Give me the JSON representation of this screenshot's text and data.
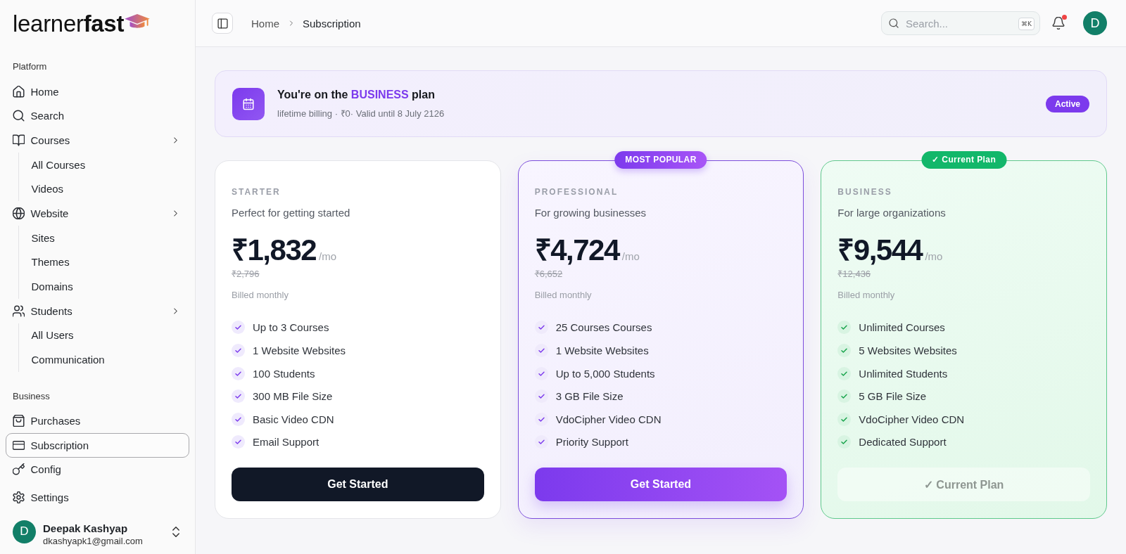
{
  "sidebar": {
    "logo": "learner**fast**",
    "sections": [
      {
        "label": "Platform",
        "items": [
          {
            "label": "Home",
            "selected": false
          },
          {
            "label": "Search",
            "selected": false
          },
          {
            "label": "Courses",
            "selected": false,
            "children": [
              {
                "label": "All Courses",
                "selected": false
              },
              {
                "label": "Videos",
                "selected": false
              }
            ]
          },
          {
            "label": "Website",
            "selected": false,
            "children": [
              {
                "label": "Sites",
                "selected": false
              },
              {
                "label": "Themes",
                "selected": false
              },
              {
                "label": "Domains",
                "selected": false
              }
            ]
          },
          {
            "label": "Students",
            "selected": false,
            "children": [
              {
                "label": "All Users",
                "selected": false
              },
              {
                "label": "Communication",
                "selected": false
              }
            ]
          }
        ]
      },
      {
        "label": "Business",
        "items": [
          {
            "label": "Purchases",
            "selected": false
          },
          {
            "label": "Subscription",
            "selected": true
          },
          {
            "label": "Config",
            "selected": false
          }
        ]
      },
      {
        "items": [
          {
            "label": "Settings",
            "selected": false
          }
        ]
      }
    ],
    "user": {
      "avatar": "D",
      "name": "Deepak Kashyap",
      "email": "dkashyapk1@gmail.com"
    }
  },
  "header": {
    "breadcrumb": [
      "Home",
      "Subscription"
    ],
    "search": {
      "placeholder": "Search...",
      "shortcut": "⌘K"
    },
    "notifications": {
      "unread": true
    },
    "avatar": "D"
  },
  "banner": {
    "title": "You're on the **BUSINESS** plan",
    "details": "lifetime billing · ₹0· Valid until 8 July 2126",
    "status": "Active"
  },
  "plans": [
    {
      "kind": "standard",
      "name": "STARTER",
      "tagline": "Perfect for getting started",
      "price": "₹1,832",
      "period": "/mo",
      "original_price": "₹2,796",
      "billing": "Billed monthly",
      "features": [
        "Up to 3 Courses",
        "1 Website Websites",
        "100 Students",
        "300 MB File Size",
        "Basic Video CDN",
        "Email Support"
      ],
      "button": {
        "label": "Get Started",
        "disabled": false
      }
    },
    {
      "kind": "featured",
      "badge": "MOST POPULAR",
      "name": "PROFESSIONAL",
      "tagline": "For growing businesses",
      "price": "₹4,724",
      "period": "/mo",
      "original_price": "₹6,652",
      "billing": "Billed monthly",
      "features": [
        "25 Courses Courses",
        "1 Website Websites",
        "Up to 5,000 Students",
        "3 GB File Size",
        "VdoCipher Video CDN",
        "Priority Support"
      ],
      "button": {
        "label": "Get Started",
        "disabled": false
      }
    },
    {
      "kind": "current",
      "badge": "✓ Current Plan",
      "name": "BUSINESS",
      "tagline": "For large organizations",
      "price": "₹9,544",
      "period": "/mo",
      "original_price": "₹12,436",
      "billing": "Billed monthly",
      "features": [
        "Unlimited Courses",
        "5 Websites Websites",
        "Unlimited Students",
        "5 GB File Size",
        "VdoCipher Video CDN",
        "Dedicated Support"
      ],
      "button": {
        "label": "✓ Current Plan",
        "disabled": true
      }
    }
  ]
}
